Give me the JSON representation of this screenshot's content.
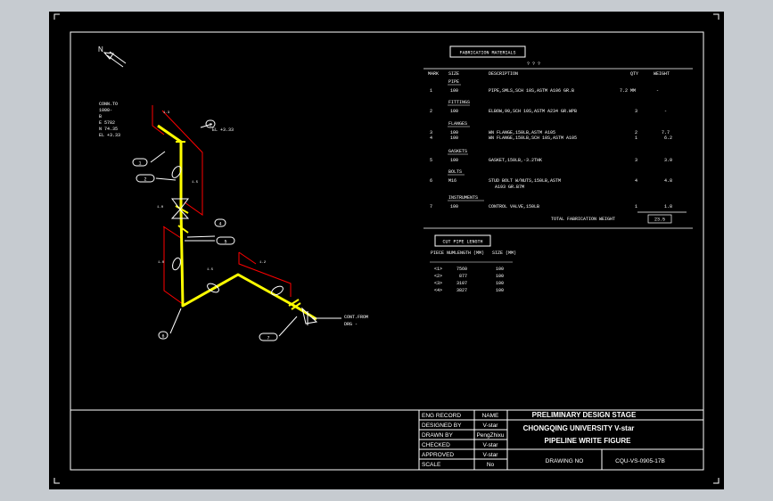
{
  "north_label": "N",
  "bom": {
    "title": "FABRICATION MATERIALS",
    "sub_title": "? ? ?",
    "headers": [
      "MARK",
      "SIZE",
      "DESCRIPTION",
      "QTY",
      "WEIGHT"
    ],
    "sections": [
      {
        "name": "PIPE",
        "rows": [
          {
            "mark": "1",
            "size": "100",
            "desc": "PIPE,SMLS,SCH 10S,ASTM A106 GR.B",
            "qty": "7.2 MM",
            "weight": "-"
          }
        ]
      },
      {
        "name": "FITTINGS",
        "rows": [
          {
            "mark": "2",
            "size": "100",
            "desc": "ELBOW,90,SCH 10S,ASTM A234 GR.WPB",
            "qty": "3",
            "weight": "-"
          }
        ]
      },
      {
        "name": "FLANGES",
        "rows": [
          {
            "mark": "3",
            "size": "100",
            "desc": "WN FLANGE,150LB,ASTM A105",
            "qty": "2",
            "weight": "7.7"
          },
          {
            "mark": "4",
            "size": "100",
            "desc": "WN FLANGE,150LB,SCH 10S,ASTM A105",
            "qty": "1",
            "weight": "6.2"
          }
        ]
      },
      {
        "name": "GASKETS",
        "rows": [
          {
            "mark": "5",
            "size": "100",
            "desc": "GASKET,150LB,-3.2THK",
            "qty": "3",
            "weight": "3.0"
          }
        ]
      },
      {
        "name": "BOLTS",
        "rows": [
          {
            "mark": "6",
            "size": "M16",
            "desc": "STUD BOLT W/NUTS,150LB,ASTM",
            "desc2": "A193 GR.B7M",
            "qty": "4",
            "weight": "4.8"
          }
        ]
      },
      {
        "name": "INSTRUMENTS",
        "rows": [
          {
            "mark": "7",
            "size": "100",
            "desc": "CONTROL VALVE,150LB",
            "qty": "1",
            "weight": "1.8"
          }
        ]
      }
    ],
    "total_label": "TOTAL FABRICATION WEIGHT",
    "total_value": "23.5"
  },
  "cut_pipe": {
    "title": "CUT PIPE LENGTH",
    "headers": [
      "PIECE NUM",
      "LENGTH (MM)",
      "SIZE (MM)"
    ],
    "rows": [
      {
        "piece": "<1>",
        "length": "7560",
        "size": "100"
      },
      {
        "piece": "<2>",
        "length": "877",
        "size": "100"
      },
      {
        "piece": "<3>",
        "length": "3107",
        "size": "100"
      },
      {
        "piece": "<4>",
        "length": "3827",
        "size": "100"
      }
    ]
  },
  "iso_notes": {
    "conn_top": [
      "CONN.TO",
      "1000-",
      "B",
      "E 5782",
      "N 74.35",
      "EL +3.33"
    ],
    "conn_right": [
      "CONT.FROM",
      "DRG -"
    ],
    "callouts": [
      "1",
      "2",
      "3",
      "4",
      "5",
      "6",
      "7",
      "8"
    ],
    "dims": [
      "1.3",
      "1.5",
      "1.0",
      "1.0",
      "1.5",
      "1.2"
    ],
    "elev_note": "EL +3.33"
  },
  "title_block": {
    "rows": [
      {
        "label": "ENG RECORD",
        "value": "NAME"
      },
      {
        "label": "DESIGNED BY",
        "value": "V-star"
      },
      {
        "label": "DRAWN BY",
        "value": "PengZhixu"
      },
      {
        "label": "CHECKED",
        "value": "V-star"
      },
      {
        "label": "APPROVED",
        "value": "V-star"
      },
      {
        "label": "SCALE",
        "value": "No"
      }
    ],
    "stage": "PRELIMINARY DESIGN STAGE",
    "university": "CHONGQING UNIVERSITY V-star",
    "figure": "PIPELINE WRITE FIGURE",
    "drawing_no_label": "DRAWING NO",
    "drawing_no": "CQU-VS-0905-17B"
  },
  "colors": {
    "background": "#000000",
    "viewport": "#c6cbd0",
    "line": "#ffffff",
    "pipe": "#ffff00",
    "dimension": "#ff0000"
  }
}
